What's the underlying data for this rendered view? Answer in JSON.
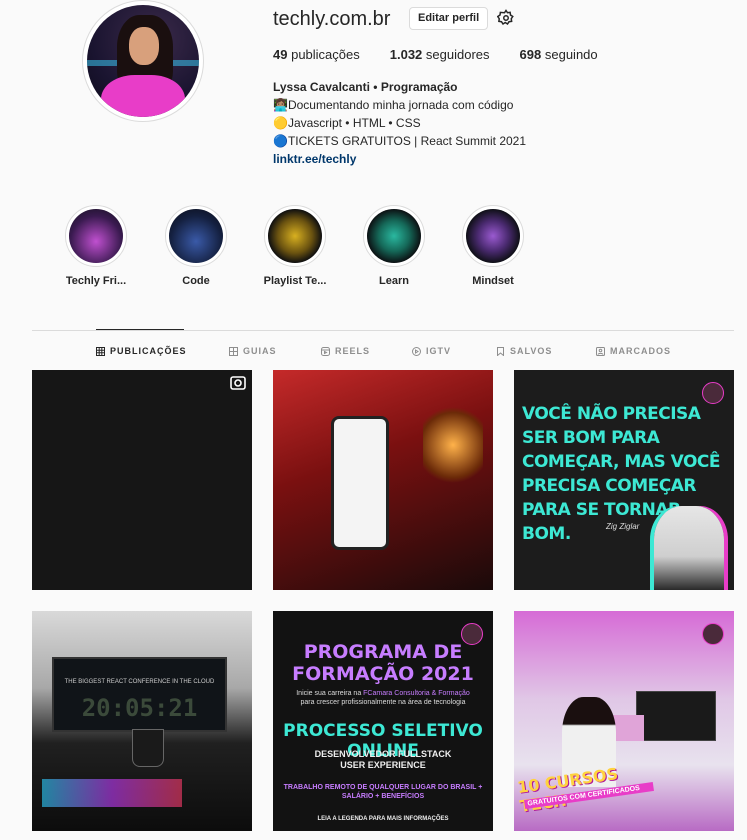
{
  "profile": {
    "username": "techly.com.br",
    "edit_label": "Editar perfil",
    "stats": {
      "posts_count": "49",
      "posts_label": "publicações",
      "followers_count": "1.032",
      "followers_label": "seguidores",
      "following_count": "698",
      "following_label": "seguindo"
    },
    "bio": {
      "name": "Lyssa Cavalcanti • Programação",
      "line1": "👩🏽‍💻Documentando minha jornada com código",
      "line2": "🟡Javascript • HTML • CSS",
      "line3": "🔵TICKETS GRATUITOS | React Summit 2021",
      "link": "linktr.ee/techly"
    }
  },
  "highlights": [
    {
      "label": "Techly Fri..."
    },
    {
      "label": "Code"
    },
    {
      "label": "Playlist Te..."
    },
    {
      "label": "Learn"
    },
    {
      "label": "Mindset"
    }
  ],
  "tabs": [
    {
      "label": "PUBLICAÇÕES",
      "icon": "grid-icon",
      "active": true
    },
    {
      "label": "GUIAS",
      "icon": "guide-icon",
      "active": false
    },
    {
      "label": "REELS",
      "icon": "reels-icon",
      "active": false
    },
    {
      "label": "IGTV",
      "icon": "igtv-icon",
      "active": false
    },
    {
      "label": "SALVOS",
      "icon": "bookmark-icon",
      "active": false
    },
    {
      "label": "MARCADOS",
      "icon": "tagged-icon",
      "active": false
    }
  ],
  "posts": {
    "p3": {
      "quote": "VOCÊ NÃO PRECISA SER BOM PARA COMEÇAR, MAS VOCÊ PRECISA COMEÇAR PARA SE TORNAR BOM.",
      "author": "Zig Ziglar"
    },
    "p4": {
      "screen_text": "THE BIGGEST REACT CONFERENCE IN THE CLOUD",
      "clock": "20:05:21"
    },
    "p5": {
      "title": "PROGRAMA DE FORMAÇÃO 2021",
      "subtitle_a": "Inicie sua carreira na ",
      "subtitle_highlight": "FCamara Consultoria & Formação",
      "subtitle_b": "para crescer profissionalmente na área de tecnologia",
      "headline": "PROCESSO SELETIVO ONLINE",
      "roles": "DESENVOLVEDOR FULLSTACK\nUSER EXPERIENCE",
      "details": "TRABALHO REMOTO DE QUALQUER LUGAR DO BRASIL +\nSALÁRIO + BENEFÍCIOS",
      "cta": "LEIA A LEGENDA PARA MAIS INFORMAÇÕES"
    },
    "p6": {
      "banner": "10 CURSOS TECH",
      "banner_sub": "GRATUITOS COM CERTIFICADOS"
    }
  }
}
